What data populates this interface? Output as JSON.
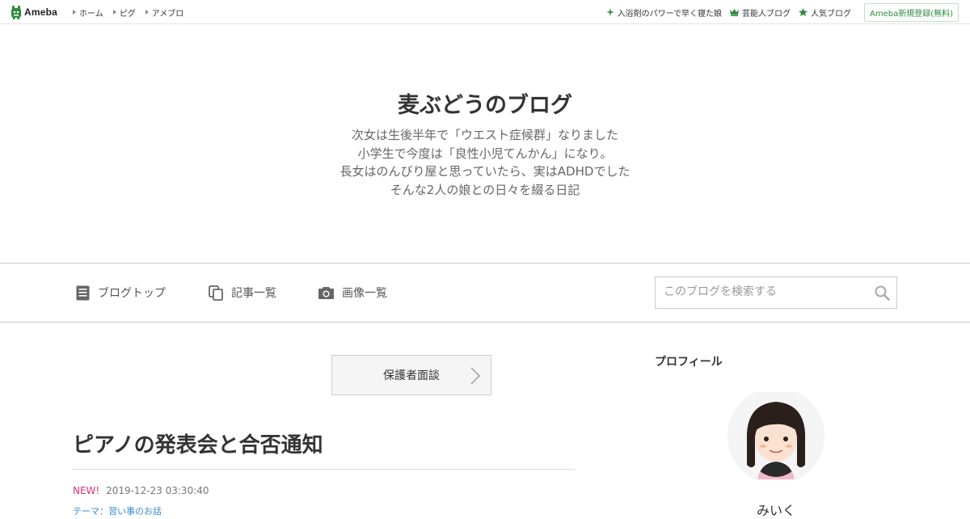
{
  "topbar": {
    "logo": "Ameba",
    "nav": [
      "ホーム",
      "ピグ",
      "アメブロ"
    ],
    "right": [
      {
        "label": "入浴剤のパワーで早く寝た娘",
        "icon": "sparkle-icon"
      },
      {
        "label": "芸能人ブログ",
        "icon": "crown-icon"
      },
      {
        "label": "人気ブログ",
        "icon": "star-icon"
      }
    ],
    "register": "Ameba新規登録(無料)"
  },
  "header": {
    "title": "麦ぶどうのブログ",
    "description": [
      "次女は生後半年で「ウエスト症候群」なりました",
      "小学生で今度は「良性小児てんかん」になり。",
      "長女はのんびり屋と思っていたら、実はADHDでした",
      "そんな2人の娘との日々を綴る日記"
    ]
  },
  "nav": {
    "items": [
      {
        "label": "ブログトップ",
        "icon": "document-icon"
      },
      {
        "label": "記事一覧",
        "icon": "copy-icon"
      },
      {
        "label": "画像一覧",
        "icon": "camera-icon"
      }
    ],
    "search_placeholder": "このブログを検索する"
  },
  "main": {
    "theme_button": "保護者面談",
    "entry": {
      "title": "ピアノの発表会と合否通知",
      "new_badge": "NEW!",
      "datetime": "2019-12-23 03:30:40",
      "theme": "テーマ：習い事のお話"
    }
  },
  "sidebar": {
    "heading": "プロフィール",
    "name": "みいく"
  },
  "colors": {
    "ameba_green": "#2d8c3c",
    "new_pink": "#e3307a",
    "link_blue": "#3a8dcc"
  }
}
